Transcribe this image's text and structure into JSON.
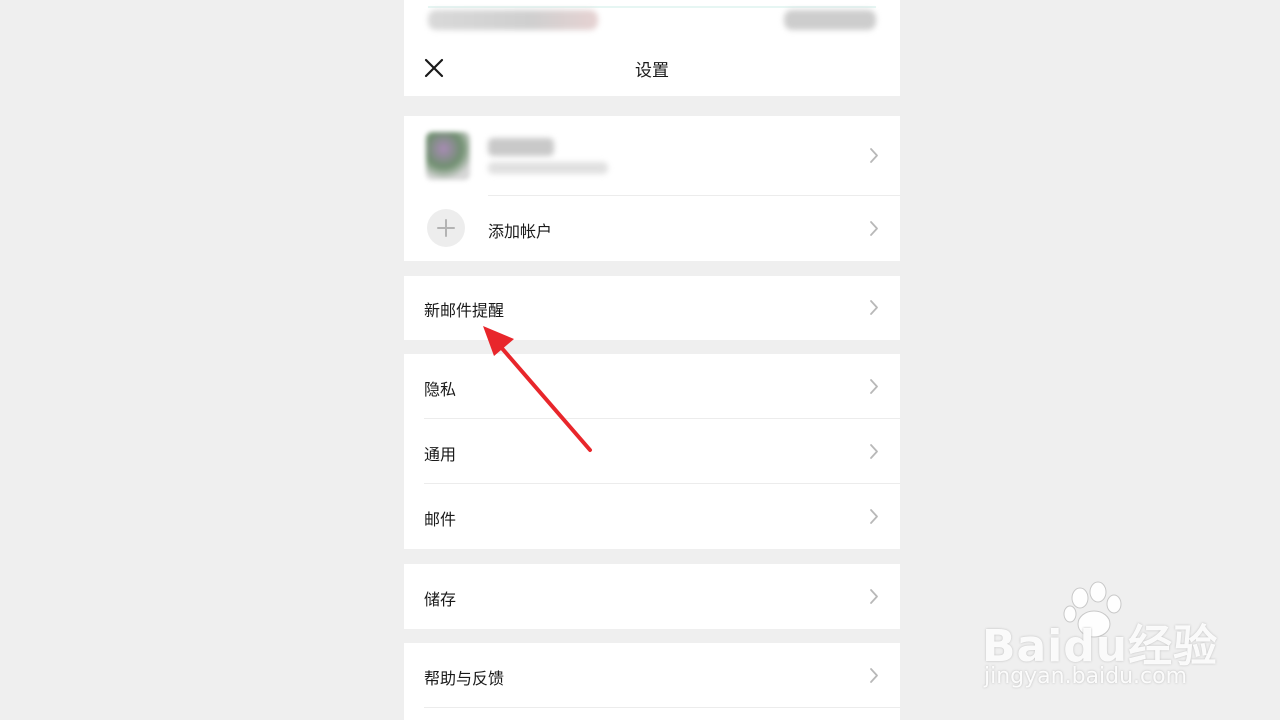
{
  "header": {
    "title": "设置",
    "close_icon": "close-icon"
  },
  "accounts": {
    "add_account_label": "添加帐户",
    "add_icon": "plus-icon"
  },
  "menu": {
    "new_mail_alert": "新邮件提醒",
    "privacy": "隐私",
    "general": "通用",
    "mail": "邮件",
    "storage": "储存",
    "help_feedback": "帮助与反馈"
  },
  "annotation": {
    "arrow_color": "#e8262b"
  },
  "watermark": {
    "brand": "Baidu经验",
    "url": "jingyan.baidu.com"
  },
  "colors": {
    "background": "#efefef",
    "card": "#ffffff",
    "text": "#1a1a1a",
    "chevron": "#b8b8b8"
  }
}
